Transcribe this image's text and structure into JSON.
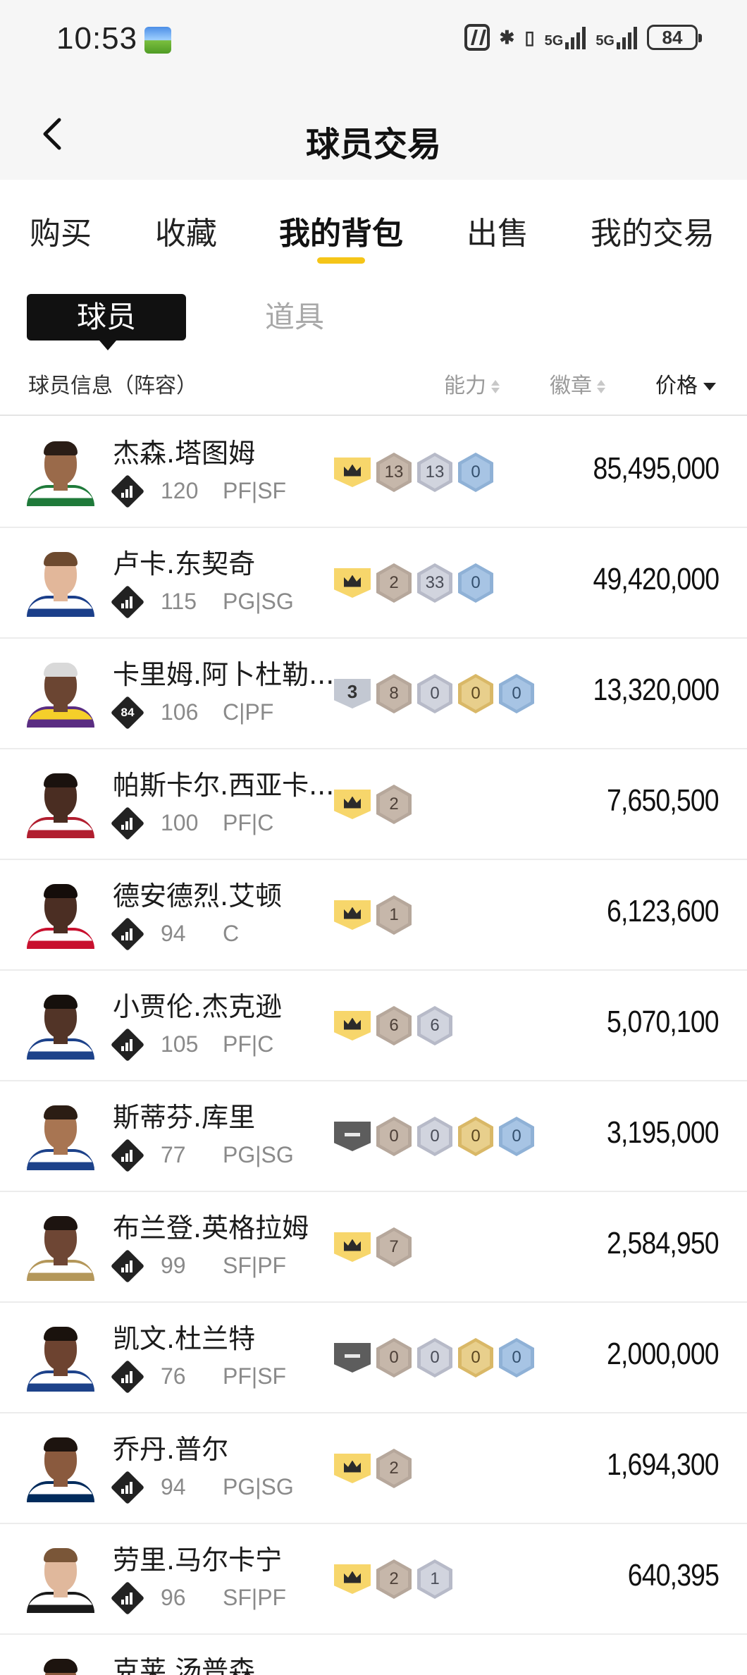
{
  "status_bar": {
    "time": "10:53",
    "network_1": "5G",
    "network_2": "5G",
    "battery": "84"
  },
  "header": {
    "title": "球员交易"
  },
  "tabs": [
    {
      "label": "购买",
      "active": false
    },
    {
      "label": "收藏",
      "active": false
    },
    {
      "label": "我的背包",
      "active": true
    },
    {
      "label": "出售",
      "active": false
    },
    {
      "label": "我的交易",
      "active": false
    }
  ],
  "subtabs": {
    "player": "球员",
    "item": "道具"
  },
  "columns": {
    "info": "球员信息（阵容）",
    "ability": "能力",
    "badge": "徽章",
    "price": "价格"
  },
  "colors": {
    "accent": "#f5c518",
    "crown_badge": "#f7d66b",
    "bronze": "#c6b7aa",
    "silver": "#d1d4de",
    "gold": "#e8cf8c",
    "blue": "#a7c4e4"
  },
  "players": [
    {
      "name": "杰森.塔图姆",
      "rating": "120",
      "position": "PF|SF",
      "ovr_icon": "bars-icon",
      "ovr_num": "",
      "ability": {
        "type": "crown",
        "label": ""
      },
      "badges": [
        {
          "tier": "bronze",
          "value": "13"
        },
        {
          "tier": "silver",
          "value": "13"
        },
        {
          "tier": "blue",
          "value": "0"
        }
      ],
      "price": "85,495,000",
      "skin": "#9a6a4a",
      "hair": "#2a1d16",
      "jersey": "#ffffff",
      "trim": "#1f7a3a"
    },
    {
      "name": "卢卡.东契奇",
      "rating": "115",
      "position": "PG|SG",
      "ovr_icon": "bars-icon",
      "ovr_num": "",
      "ability": {
        "type": "crown",
        "label": ""
      },
      "badges": [
        {
          "tier": "bronze",
          "value": "2"
        },
        {
          "tier": "silver",
          "value": "33"
        },
        {
          "tier": "blue",
          "value": "0"
        }
      ],
      "price": "49,420,000",
      "skin": "#e2b79a",
      "hair": "#6d4a2f",
      "jersey": "#ffffff",
      "trim": "#1b3f8a"
    },
    {
      "name": "卡里姆.阿卜杜勒...",
      "rating": "106",
      "position": "C|PF",
      "ovr_icon": "num-icon",
      "ovr_num": "84",
      "ability": {
        "type": "silver",
        "label": "3"
      },
      "badges": [
        {
          "tier": "bronze",
          "value": "8"
        },
        {
          "tier": "silver",
          "value": "0"
        },
        {
          "tier": "gold",
          "value": "0"
        },
        {
          "tier": "blue",
          "value": "0"
        }
      ],
      "price": "13,320,000",
      "skin": "#6b4532",
      "hair": "#d9d9d9",
      "jersey": "#f5cf2a",
      "trim": "#5a2d82"
    },
    {
      "name": "帕斯卡尔.西亚卡...",
      "rating": "100",
      "position": "PF|C",
      "ovr_icon": "bars-icon",
      "ovr_num": "",
      "ability": {
        "type": "crown",
        "label": ""
      },
      "badges": [
        {
          "tier": "bronze",
          "value": "2"
        }
      ],
      "price": "7,650,500",
      "skin": "#4a2d22",
      "hair": "#1a120e",
      "jersey": "#ffffff",
      "trim": "#b11e2f"
    },
    {
      "name": "德安德烈.艾顿",
      "rating": "94",
      "position": "C",
      "ovr_icon": "bars-icon",
      "ovr_num": "",
      "ability": {
        "type": "crown",
        "label": ""
      },
      "badges": [
        {
          "tier": "bronze",
          "value": "1"
        }
      ],
      "price": "6,123,600",
      "skin": "#4b2e23",
      "hair": "#140d0a",
      "jersey": "#ffffff",
      "trim": "#c8102e"
    },
    {
      "name": "小贾伦.杰克逊",
      "rating": "105",
      "position": "PF|C",
      "ovr_icon": "bars-icon",
      "ovr_num": "",
      "ability": {
        "type": "crown",
        "label": ""
      },
      "badges": [
        {
          "tier": "bronze",
          "value": "6"
        },
        {
          "tier": "silver",
          "value": "6"
        }
      ],
      "price": "5,070,100",
      "skin": "#523427",
      "hair": "#16100c",
      "jersey": "#ffffff",
      "trim": "#1d428a"
    },
    {
      "name": "斯蒂芬.库里",
      "rating": "77",
      "position": "PG|SG",
      "ovr_icon": "bars-icon",
      "ovr_num": "",
      "ability": {
        "type": "dark",
        "label": ""
      },
      "badges": [
        {
          "tier": "bronze",
          "value": "0"
        },
        {
          "tier": "silver",
          "value": "0"
        },
        {
          "tier": "gold",
          "value": "0"
        },
        {
          "tier": "blue",
          "value": "0"
        }
      ],
      "price": "3,195,000",
      "skin": "#a87552",
      "hair": "#2b1d14",
      "jersey": "#ffffff",
      "trim": "#1d428a"
    },
    {
      "name": "布兰登.英格拉姆",
      "rating": "99",
      "position": "SF|PF",
      "ovr_icon": "bars-icon",
      "ovr_num": "",
      "ability": {
        "type": "crown",
        "label": ""
      },
      "badges": [
        {
          "tier": "bronze",
          "value": "7"
        }
      ],
      "price": "2,584,950",
      "skin": "#6e4634",
      "hair": "#1d1410",
      "jersey": "#ffffff",
      "trim": "#b4975a"
    },
    {
      "name": "凯文.杜兰特",
      "rating": "76",
      "position": "PF|SF",
      "ovr_icon": "bars-icon",
      "ovr_num": "",
      "ability": {
        "type": "dark",
        "label": ""
      },
      "badges": [
        {
          "tier": "bronze",
          "value": "0"
        },
        {
          "tier": "silver",
          "value": "0"
        },
        {
          "tier": "gold",
          "value": "0"
        },
        {
          "tier": "blue",
          "value": "0"
        }
      ],
      "price": "2,000,000",
      "skin": "#6d4330",
      "hair": "#1a120d",
      "jersey": "#ffffff",
      "trim": "#1d428a"
    },
    {
      "name": "乔丹.普尔",
      "rating": "94",
      "position": "PG|SG",
      "ovr_icon": "bars-icon",
      "ovr_num": "",
      "ability": {
        "type": "crown",
        "label": ""
      },
      "badges": [
        {
          "tier": "bronze",
          "value": "2"
        }
      ],
      "price": "1,694,300",
      "skin": "#8a5a3e",
      "hair": "#1d140f",
      "jersey": "#ffffff",
      "trim": "#002b5c"
    },
    {
      "name": "劳里.马尔卡宁",
      "rating": "96",
      "position": "SF|PF",
      "ovr_icon": "bars-icon",
      "ovr_num": "",
      "ability": {
        "type": "crown",
        "label": ""
      },
      "badges": [
        {
          "tier": "bronze",
          "value": "2"
        },
        {
          "tier": "silver",
          "value": "1"
        }
      ],
      "price": "640,395",
      "skin": "#e0b89c",
      "hair": "#7a5638",
      "jersey": "#ffffff",
      "trim": "#1a1a1a"
    },
    {
      "name": "克莱.汤普森",
      "rating": "",
      "position": "",
      "ovr_icon": "bars-icon",
      "ovr_num": "",
      "ability": {
        "type": "none",
        "label": ""
      },
      "badges": [],
      "price": "",
      "skin": "#8a5a3e",
      "hair": "#1d140f",
      "jersey": "#ffffff",
      "trim": "#1d428a"
    }
  ]
}
